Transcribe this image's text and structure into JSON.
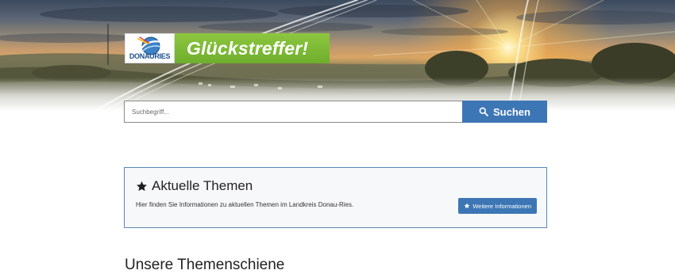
{
  "header": {
    "logo_text": "DONAURIES",
    "slogan": "Glückstreffer!"
  },
  "search": {
    "placeholder": "Suchbegriff...",
    "button_label": "Suchen"
  },
  "topics_card": {
    "title": "Aktuelle Themen",
    "text": "Hier finden Sie Informationen zu aktuellen Themen im Landkreis Donau-Ries.",
    "button_label": "Weitere Informationen"
  },
  "next_section": {
    "heading": "Unsere Themenschiene"
  },
  "colors": {
    "primary_blue": "#3d76b5",
    "slogan_green": "#7cba34",
    "card_border": "#5a88b8"
  },
  "icons": {
    "search_button": "search-icon",
    "card_title": "star-icon",
    "more_button": "star-icon"
  }
}
